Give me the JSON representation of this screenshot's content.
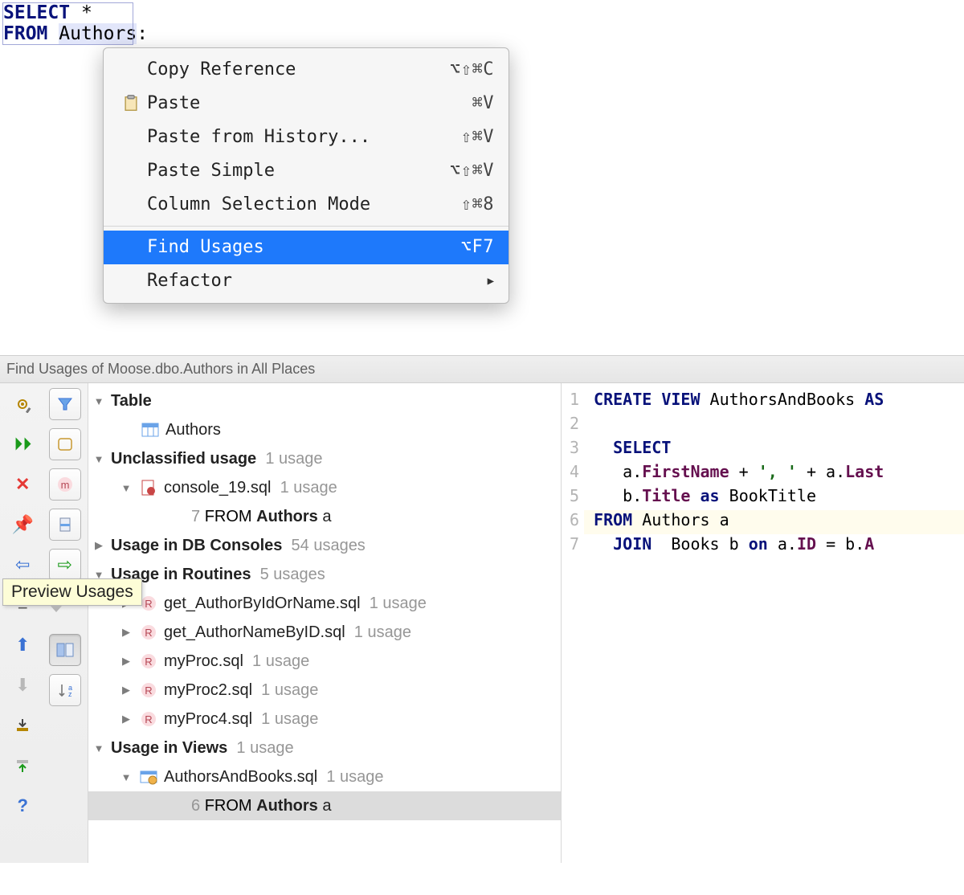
{
  "editor": {
    "line1_kw": "SELECT",
    "line1_rest": " *",
    "line2_kw": "FROM",
    "line2_sp": " ",
    "line2_ident": "Authors",
    "line2_tail": ":"
  },
  "context_menu": {
    "items": [
      {
        "icon": "",
        "label": "Copy Reference",
        "shortcut": "⌥⇧⌘C"
      },
      {
        "icon": "paste",
        "label": "Paste",
        "shortcut": "⌘V"
      },
      {
        "icon": "",
        "label": "Paste from History...",
        "shortcut": "⇧⌘V"
      },
      {
        "icon": "",
        "label": "Paste Simple",
        "shortcut": "⌥⇧⌘V"
      },
      {
        "icon": "",
        "label": "Column Selection Mode",
        "shortcut": "⇧⌘8"
      }
    ],
    "find_usages": {
      "label": "Find Usages",
      "shortcut": "⌥F7"
    },
    "refactor": {
      "label": "Refactor"
    }
  },
  "find_header": "Find Usages of Moose.dbo.Authors in All Places",
  "tooltip": "Preview Usages",
  "tree": {
    "table_label": "Table",
    "authors_leaf": "Authors",
    "unclassified_label": "Unclassified usage",
    "unclassified_count": "1 usage",
    "console_name": "console_19.sql",
    "console_count": "1 usage",
    "console_line_no": "7",
    "console_line_kw": "FROM",
    "console_line_ident": "Authors",
    "console_line_alias": "a",
    "db_consoles_label": "Usage in DB Consoles",
    "db_consoles_count": "54 usages",
    "routines_label": "Usage in Routines",
    "routines_count": "5 usages",
    "routines": [
      {
        "name": "get_AuthorByIdOrName.sql",
        "count": "1 usage"
      },
      {
        "name": "get_AuthorNameByID.sql",
        "count": "1 usage"
      },
      {
        "name": "myProc.sql",
        "count": "1 usage"
      },
      {
        "name": "myProc2.sql",
        "count": "1 usage"
      },
      {
        "name": "myProc4.sql",
        "count": "1 usage"
      }
    ],
    "views_label": "Usage in Views",
    "views_count": "1 usage",
    "view_file": "AuthorsAndBooks.sql",
    "view_file_count": "1 usage",
    "view_line_no": "6",
    "view_line_kw": "FROM",
    "view_line_ident": "Authors",
    "view_line_alias": "a"
  },
  "preview": {
    "lines": [
      "1",
      "2",
      "3",
      "4",
      "5",
      "6",
      "7"
    ],
    "l1": {
      "a": "CREATE",
      "b": "VIEW",
      "c": " AuthorsAndBooks ",
      "d": "AS"
    },
    "l3": {
      "kw": "SELECT"
    },
    "l4": {
      "a": "    a.",
      "f1": "FirstName",
      "b": " + ",
      "s": "', '",
      "c": " + a.",
      "f2": "Last"
    },
    "l5": {
      "a": "    b.",
      "f1": "Title",
      "kw": "as",
      "c": " BookTitle"
    },
    "l6": {
      "kw": "FROM",
      "txt": " Authors a"
    },
    "l7": {
      "kw": "JOIN",
      "a": "  Books b ",
      "kw2": "on",
      "b": " a.",
      "f1": "ID",
      "c": " = b.",
      "f2": "A"
    }
  }
}
